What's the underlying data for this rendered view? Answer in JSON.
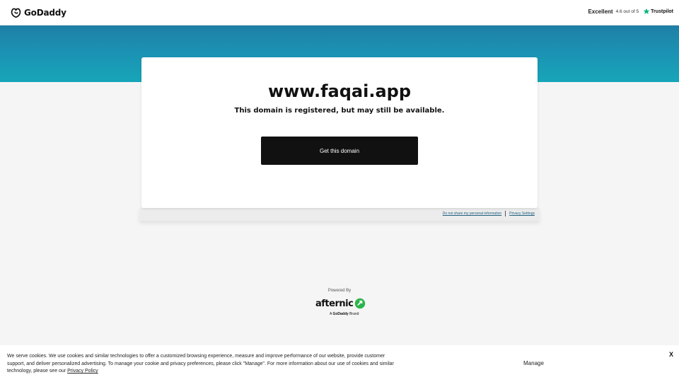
{
  "header": {
    "brand": "GoDaddy",
    "rating_word": "Excellent",
    "rating_score": "4.6 out of 5",
    "trustpilot_label": "Trustpilot",
    "colors": {
      "star": "#00b67a"
    }
  },
  "card": {
    "domain": "www.faqai.app",
    "subline": "This domain is registered, but may still be available.",
    "cta_label": "Get this domain"
  },
  "privacy": {
    "do_not_share": "Do not share my personal information",
    "privacy_settings": "Privacy Settings"
  },
  "powered": {
    "label": "Powered By",
    "brand": "afternic",
    "sub_prefix": "A",
    "sub_brand": "GoDaddy",
    "sub_suffix": "Brand",
    "colors": {
      "mark": "#2ab54a"
    }
  },
  "cookie": {
    "text": "We serve cookies. We use cookies and similar technologies to offer a customized browsing experience, measure and improve performance of our website, provide customer support, and deliver personalized advertising. To manage your cookie and privacy preferences, please click \"Manage\". For more information about our use of cookies and similar technology, please see our",
    "policy_link": "Privacy Policy",
    "manage_label": "Manage",
    "close_label": "X"
  },
  "banner": {
    "colors": {
      "top": "#1e7fa6",
      "bottom": "#17a6b8"
    }
  }
}
